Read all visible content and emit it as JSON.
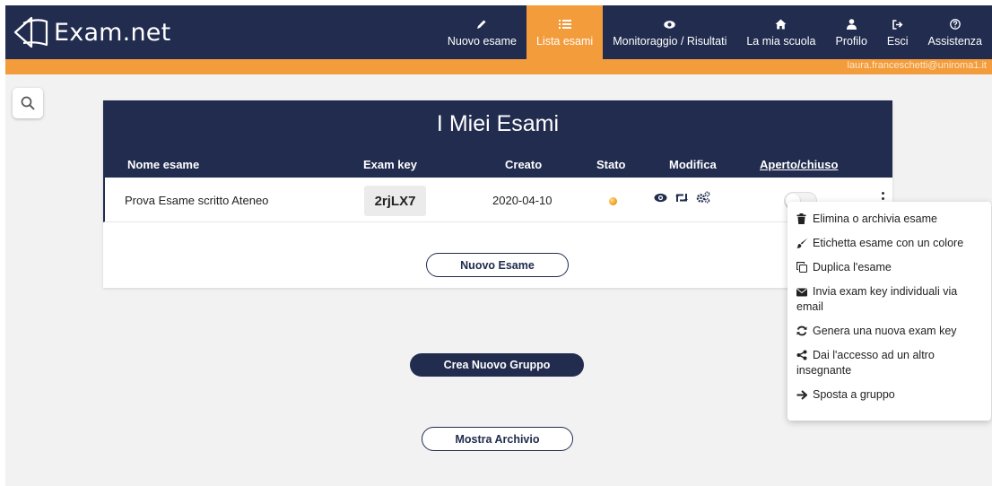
{
  "brand": {
    "name": "Exam.net"
  },
  "nav": {
    "items": [
      {
        "label": "Nuovo esame",
        "icon": "pencil-icon",
        "active": false
      },
      {
        "label": "Lista esami",
        "icon": "list-icon",
        "active": true
      },
      {
        "label": "Monitoraggio / Risultati",
        "icon": "eye-icon",
        "active": false
      },
      {
        "label": "La mia scuola",
        "icon": "home-icon",
        "active": false
      },
      {
        "label": "Profilo",
        "icon": "user-icon",
        "active": false
      },
      {
        "label": "Esci",
        "icon": "sign-out-icon",
        "active": false
      },
      {
        "label": "Assistenza",
        "icon": "help-icon",
        "active": false
      }
    ]
  },
  "user": {
    "email": "laura.franceschetti@uniroma1.it"
  },
  "colors": {
    "navy": "#212c4f",
    "orange": "#f39c3c",
    "background": "#f2f2f2"
  },
  "exams": {
    "title": "I Miei Esami",
    "columns": {
      "name": "Nome esame",
      "key": "Exam key",
      "created": "Creato",
      "status": "Stato",
      "edit": "Modifica",
      "open_closed": "Aperto/chiuso"
    },
    "rows": [
      {
        "name": "Prova Esame scritto Ateneo",
        "key": "2rjLX7",
        "created": "2020-04-10",
        "status": "in-progress",
        "open": false
      }
    ],
    "new_exam_button": "Nuovo Esame"
  },
  "actions": {
    "new_group_button": "Crea Nuovo Gruppo",
    "show_archive_button": "Mostra Archivio"
  },
  "context_menu": {
    "items": [
      {
        "label": "Elimina o archivia esame",
        "icon": "trash-icon"
      },
      {
        "label": "Etichetta esame con un colore",
        "icon": "paintbrush-icon"
      },
      {
        "label": "Duplica l'esame",
        "icon": "copy-icon"
      },
      {
        "label": "Invia exam key individuali via email",
        "icon": "envelope-icon"
      },
      {
        "label": "Genera una nuova exam key",
        "icon": "refresh-icon"
      },
      {
        "label": "Dai l'accesso ad un altro insegnante",
        "icon": "share-icon"
      },
      {
        "label": "Sposta a gruppo",
        "icon": "arrow-right-icon"
      }
    ]
  }
}
